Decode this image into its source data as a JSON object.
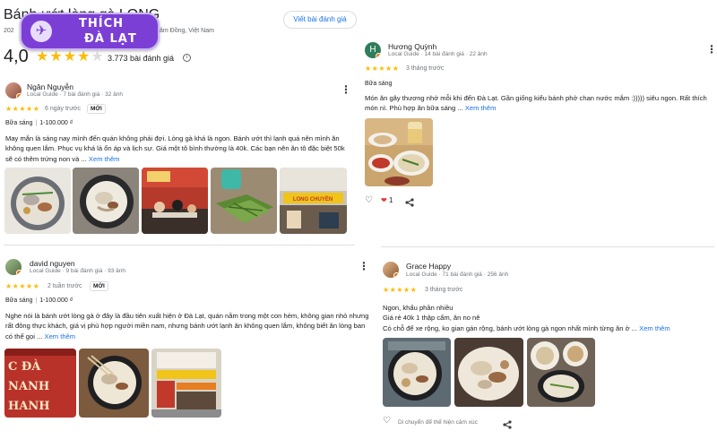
{
  "place": {
    "title": "Bánh ướt lòng gà LONG",
    "sub_left": "202",
    "sub_right": "âm Đồng, Việt Nam",
    "rating": "4,0",
    "stars": "★★★★★",
    "review_count": "3.773 bài đánh giá",
    "info_icon": "i",
    "write_review": "Viết bài đánh giá"
  },
  "logo": {
    "line1": "THÍCH",
    "line2": "ĐÀ LẠT",
    "plane_icon": "✈"
  },
  "reviews": [
    {
      "name": "Ngân Nguyễn",
      "meta": "Local Guide · 7 bài đánh giá · 32 ảnh",
      "stars": "★★★★★",
      "when": "6 ngày trước",
      "badge": "MỚI",
      "meal": "Bữa sáng",
      "price": "1-100.000 ₫",
      "text": "May mắn là sáng nay mình đến quán không phải đợi. Lòng gà khá là ngon. Bánh ướt thì lạnh quá nên mình ăn không quen lắm. Phục vụ khá là ổn áp và lịch sự. Giá một tô bình thường là 40k. Các bạn nên ăn tô đặc biệt 50k sẽ có thêm trứng non và ...",
      "more": "Xem thêm",
      "photo_sign": "LONG CHUYỀN"
    },
    {
      "name": "david nguyen",
      "meta": "Local Guide · 9 bài đánh giá · 93 ảnh",
      "stars": "★★★★★",
      "when": "2 tuần trước",
      "badge": "MỚI",
      "meal": "Bữa sáng",
      "price": "1-100.000 ₫",
      "text": "Nghe nói là bánh ướt lòng gà ở đây là đầu tiên xuất hiện ở Đà Lạt, quán nằm trong một con hẻm, không gian nhỏ nhưng rất đông thực khách, giá vị phù hợp người miền nam, nhưng bánh ướt lạnh ăn không quen lắm, không biết ăn lòng ban có thể gọi ...",
      "more": "Xem thêm",
      "photo_sign1": "C ĐÀ\nNANH\nHANH"
    },
    {
      "name": "Hương Quỳnh",
      "initial": "H",
      "meta": "Local Guide · 14 bài đánh giá · 22 ảnh",
      "stars": "★★★★★",
      "when": "3 tháng trước",
      "meal": "Bữa sáng",
      "text": "Món ăn gây thương nhớ mỗi khi đến Đà Lạt. Gần giống kiểu bánh phở chan nước mắm :))))) siêu ngon. Rất thích món nì. Phù hợp ăn bữa sáng ...",
      "more": "Xem thêm",
      "like_count": "1"
    },
    {
      "name": "Grace Happy",
      "meta": "Local Guide · 71 bài đánh giá · 256 ảnh",
      "stars": "★★★★★",
      "when": "3 tháng trước",
      "line1": "Ngon, khẩu phần nhiều",
      "line2": "Giá rẻ 40k 1 thập cẩm, ăn no nê",
      "line3": "Có chỗ để xe rộng, ko gian gán rộng, bánh ướt lòng gà ngon nhất mình từng ăn ở ...",
      "more": "Xem thêm",
      "react_text": "Di chuyển để thể hiện cảm xúc"
    }
  ],
  "icons": {
    "kebab": "⋮",
    "heart": "♡",
    "heart_filled": "❤",
    "share": "⋖"
  }
}
